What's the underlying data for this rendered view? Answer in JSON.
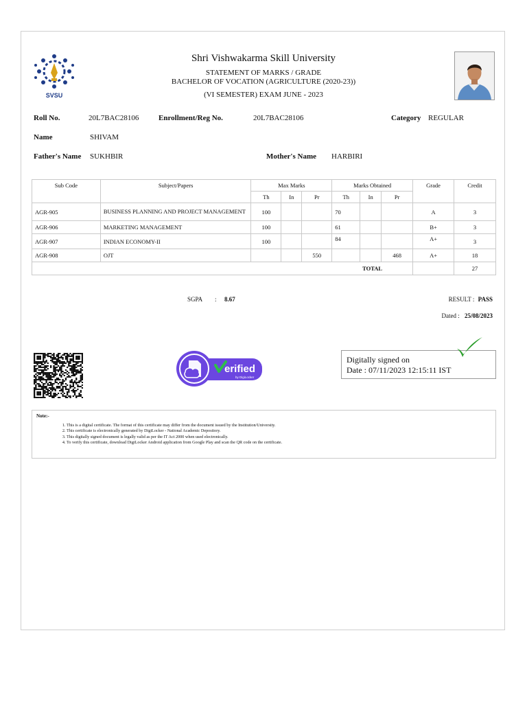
{
  "header": {
    "university": "Shri Vishwakarma Skill University",
    "statement": "STATEMENT OF MARKS / GRADE",
    "degree": "BACHELOR OF VOCATION (AGRICULTURE (2020-23))",
    "exam": "(VI SEMESTER) EXAM JUNE - 2023",
    "logo_text": "SVSU"
  },
  "student": {
    "roll_label": "Roll No.",
    "roll_value": "20L7BAC28106",
    "enroll_label": "Enrollment/Reg No.",
    "enroll_value": "20L7BAC28106",
    "category_label": "Category",
    "category_value": "REGULAR",
    "name_label": "Name",
    "name_value": "SHIVAM",
    "father_label": "Father's Name",
    "father_value": "SUKHBIR",
    "mother_label": "Mother's Name",
    "mother_value": "HARBIRI"
  },
  "table": {
    "headers": {
      "sub_code": "Sub Code",
      "subject": "Subject/Papers",
      "max_marks": "Max Marks",
      "marks_obtained": "Marks Obtained",
      "grade": "Grade",
      "credit": "Credit",
      "th": "Th",
      "in": "In",
      "pr": "Pr"
    },
    "rows": [
      {
        "code": "AGR-905",
        "subject": "BUSINESS PLANNING AND PROJECT MANAGEMENT",
        "max_th": "100",
        "max_in": "",
        "max_pr": "",
        "obt_th": "70",
        "obt_in": "",
        "obt_pr": "",
        "grade": "A",
        "credit": "3"
      },
      {
        "code": "AGR-906",
        "subject": "MARKETING MANAGEMENT",
        "max_th": "100",
        "max_in": "",
        "max_pr": "",
        "obt_th": "61",
        "obt_in": "",
        "obt_pr": "",
        "grade": "B+",
        "credit": "3"
      },
      {
        "code": "AGR-907",
        "subject": "INDIAN ECONOMY-II",
        "max_th": "100",
        "max_in": "",
        "max_pr": "",
        "obt_th": "84",
        "obt_in": "",
        "obt_pr": "",
        "grade": "A+",
        "credit": "3"
      },
      {
        "code": "AGR-908",
        "subject": "OJT",
        "max_th": "",
        "max_in": "",
        "max_pr": "550",
        "obt_th": "",
        "obt_in": "",
        "obt_pr": "468",
        "grade": "A+",
        "credit": "18"
      }
    ],
    "total_label": "TOTAL",
    "total_credit": "27"
  },
  "summary": {
    "sgpa_label": "SGPA",
    "sgpa_colon": ":",
    "sgpa_value": "8.67",
    "result_label": "RESULT :",
    "result_value": "PASS",
    "dated_label": "Dated :",
    "dated_value": "25/08/2023"
  },
  "verification": {
    "verified_text": "erified",
    "verified_sub": "by DigiLocker",
    "signed_line1": "Digitally signed on",
    "signed_line2": "Date : 07/11/2023 12:15:11 IST"
  },
  "notes": {
    "title": "Note:-",
    "items": [
      "This is a digital certificate. The format of this certificate may differ from the document issued by the Institution/University.",
      "This certificate is electronically generated by DigiLocker - National Academic Depository.",
      "This digitally signed document is legally valid as per the IT Act 2000 when used electronically.",
      "To verify this certificate, download DigiLocker Android application from Google Play and scan the QR code on the certificate."
    ]
  },
  "colors": {
    "logo_blue": "#1f3c88",
    "logo_gold": "#d9a21b",
    "verified_purple": "#6b46e0",
    "verified_green": "#2fbf4a",
    "tick_green": "#2a9d2a"
  }
}
